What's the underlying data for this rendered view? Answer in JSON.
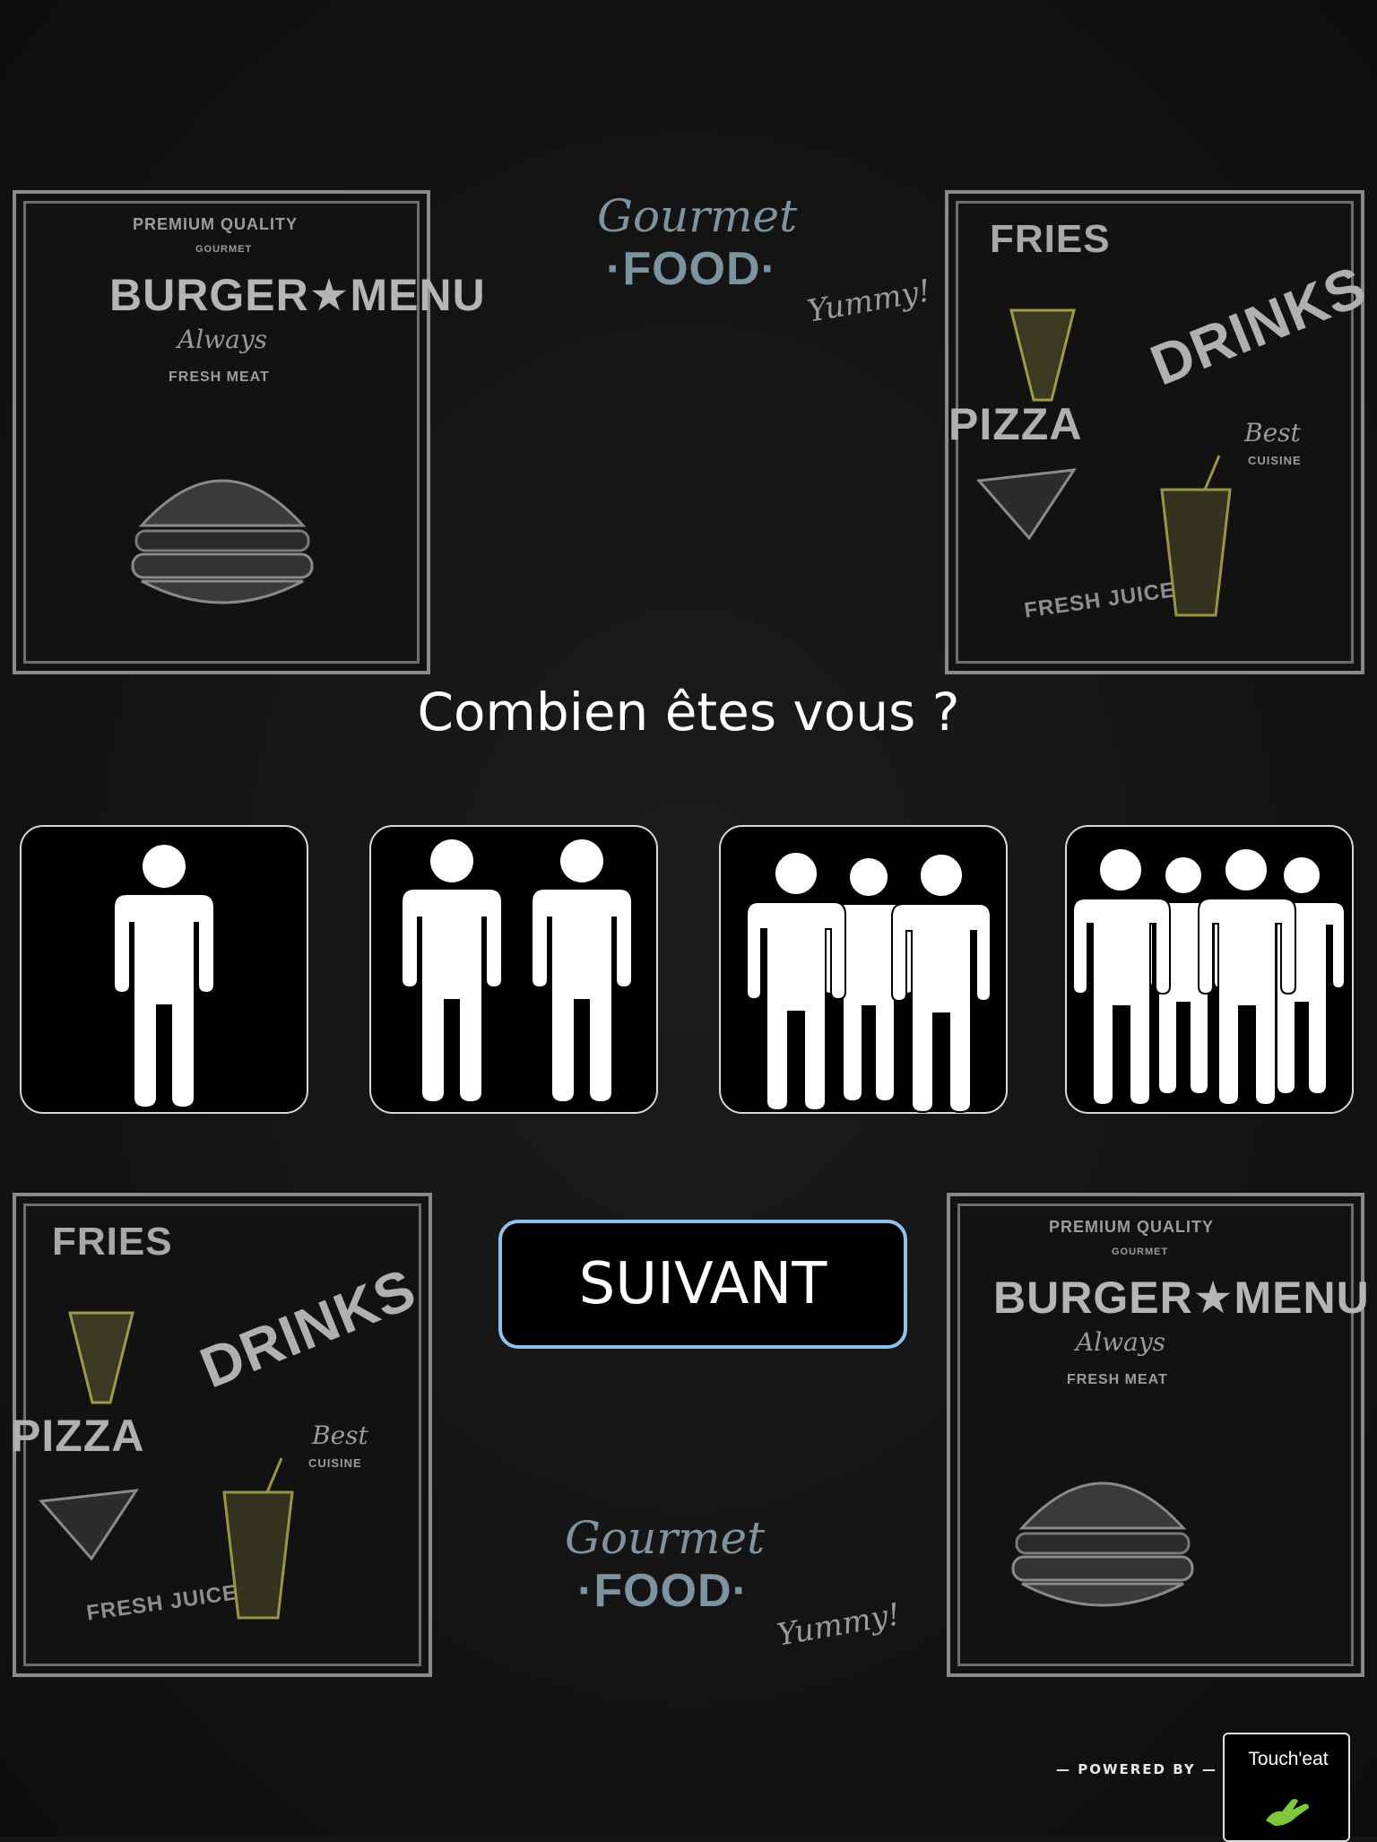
{
  "background": {
    "board_top_left": {
      "line1": "PREMIUM QUALITY",
      "line2": "GOURMET",
      "title": "BURGER★MENU",
      "script": "Always",
      "line3": "FRESH MEAT"
    },
    "board_top_right": {
      "fries": "FRIES",
      "drinks": "DRINKS",
      "pizza": "PIZZA",
      "best": "Best",
      "cuisine": "CUISINE",
      "juice": "FRESH JUICE"
    },
    "board_bottom_left": {
      "fries": "FRIES",
      "drinks": "DRINKS",
      "pizza": "PIZZA",
      "best": "Best",
      "cuisine": "CUISINE",
      "juice": "FRESH JUICE"
    },
    "board_bottom_right": {
      "line1": "PREMIUM QUALITY",
      "line2": "GOURMET",
      "title": "BURGER★MENU",
      "script": "Always",
      "line3": "FRESH MEAT"
    },
    "gourmet_top": {
      "script": "Gourmet",
      "food": "·FOOD·",
      "yummy": "Yummy!"
    },
    "gourmet_bottom": {
      "script": "Gourmet",
      "food": "·FOOD·",
      "yummy": "Yummy!"
    }
  },
  "question": "Combien êtes vous ?",
  "party_options": [
    {
      "people": 1,
      "icon": "one-person-icon"
    },
    {
      "people": 2,
      "icon": "two-people-icon"
    },
    {
      "people": 3,
      "icon": "three-people-icon"
    },
    {
      "people": 4,
      "icon": "four-people-icon"
    }
  ],
  "next_button": "SUIVANT",
  "footer": {
    "powered_by": "— POWERED BY —",
    "brand": "Touch'eat",
    "brand_icon": "hand-touch-icon"
  },
  "colors": {
    "accent_border": "#8fc2ea",
    "background": "#141414",
    "brand_green": "#7ec83a"
  }
}
